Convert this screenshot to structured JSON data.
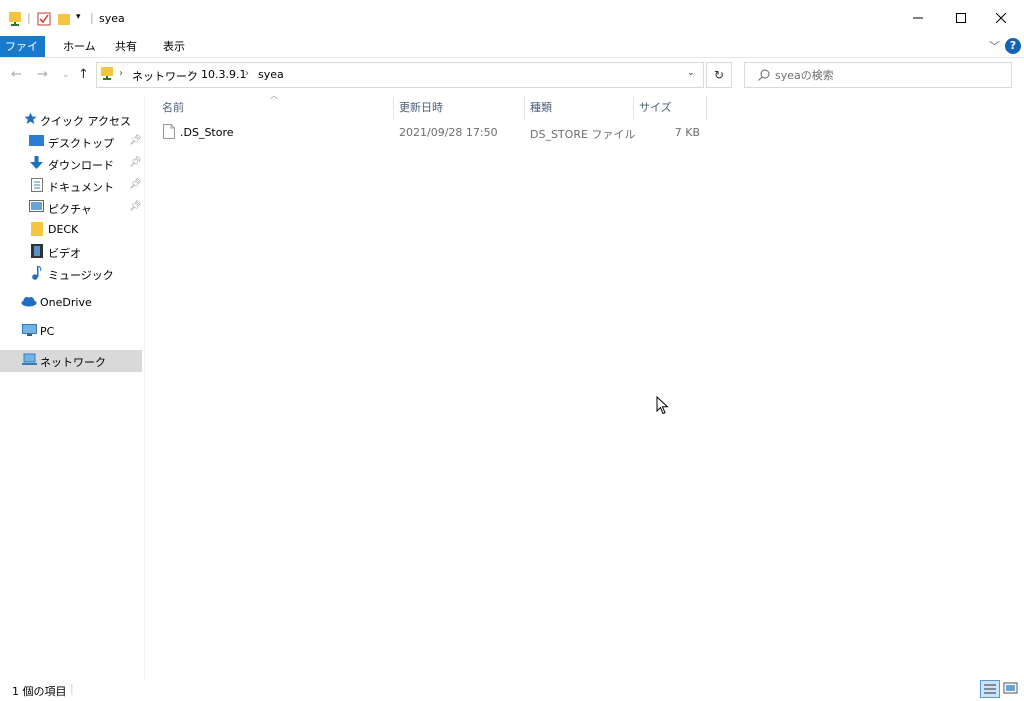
{
  "window": {
    "title": "syea"
  },
  "ribbon": {
    "tabs": [
      "ファイル",
      "ホーム",
      "共有",
      "表示"
    ]
  },
  "address": {
    "crumbs": [
      "ネットワーク",
      "10.3.9.1",
      "syea"
    ]
  },
  "search": {
    "placeholder": "syeaの検索"
  },
  "sidebar": {
    "items": [
      {
        "label": "クイック アクセス",
        "icon": "star-icon"
      },
      {
        "label": "デスクトップ",
        "icon": "desktop-icon",
        "pinned": true
      },
      {
        "label": "ダウンロード",
        "icon": "download-icon",
        "pinned": true
      },
      {
        "label": "ドキュメント",
        "icon": "documents-icon",
        "pinned": true
      },
      {
        "label": "ピクチャ",
        "icon": "pictures-icon",
        "pinned": true
      },
      {
        "label": "DECK",
        "icon": "folder-icon"
      },
      {
        "label": "ビデオ",
        "icon": "video-icon"
      },
      {
        "label": "ミュージック",
        "icon": "music-icon"
      },
      {
        "label": "OneDrive",
        "icon": "cloud-icon"
      },
      {
        "label": "PC",
        "icon": "pc-icon"
      },
      {
        "label": "ネットワーク",
        "icon": "network-icon",
        "selected": true
      }
    ]
  },
  "columns": {
    "name": "名前",
    "date": "更新日時",
    "type": "種類",
    "size": "サイズ"
  },
  "files": [
    {
      "name": ".DS_Store",
      "date": "2021/09/28 17:50",
      "type": "DS_STORE ファイル",
      "size": "7 KB"
    }
  ],
  "status": {
    "count": "1 個の項目"
  },
  "colors": {
    "accent": "#1979ca",
    "selected": "#d9d9d9",
    "header_text": "#4c607a"
  }
}
